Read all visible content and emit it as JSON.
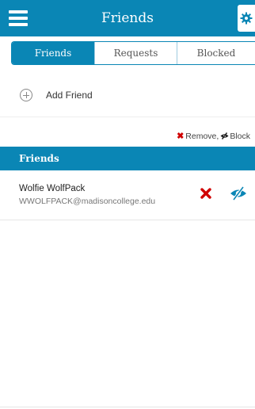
{
  "header": {
    "title": "Friends",
    "menu_icon": "hamburger-menu-icon",
    "settings_icon": "gear-icon"
  },
  "tabs": [
    {
      "label": "Friends",
      "active": true
    },
    {
      "label": "Requests",
      "active": false
    },
    {
      "label": "Blocked",
      "active": false
    }
  ],
  "add_friend": {
    "label": "Add Friend",
    "icon": "plus-circle-icon"
  },
  "legend": {
    "remove_label": "Remove,",
    "block_label": "Block"
  },
  "section": {
    "title": "Friends"
  },
  "friends": [
    {
      "name": "Wolfie WolfPack",
      "email": "WWOLFPACK@madisoncollege.edu"
    }
  ],
  "colors": {
    "primary": "#0a86b5",
    "remove": "#d00000",
    "block_icon": "#0a86b5"
  }
}
